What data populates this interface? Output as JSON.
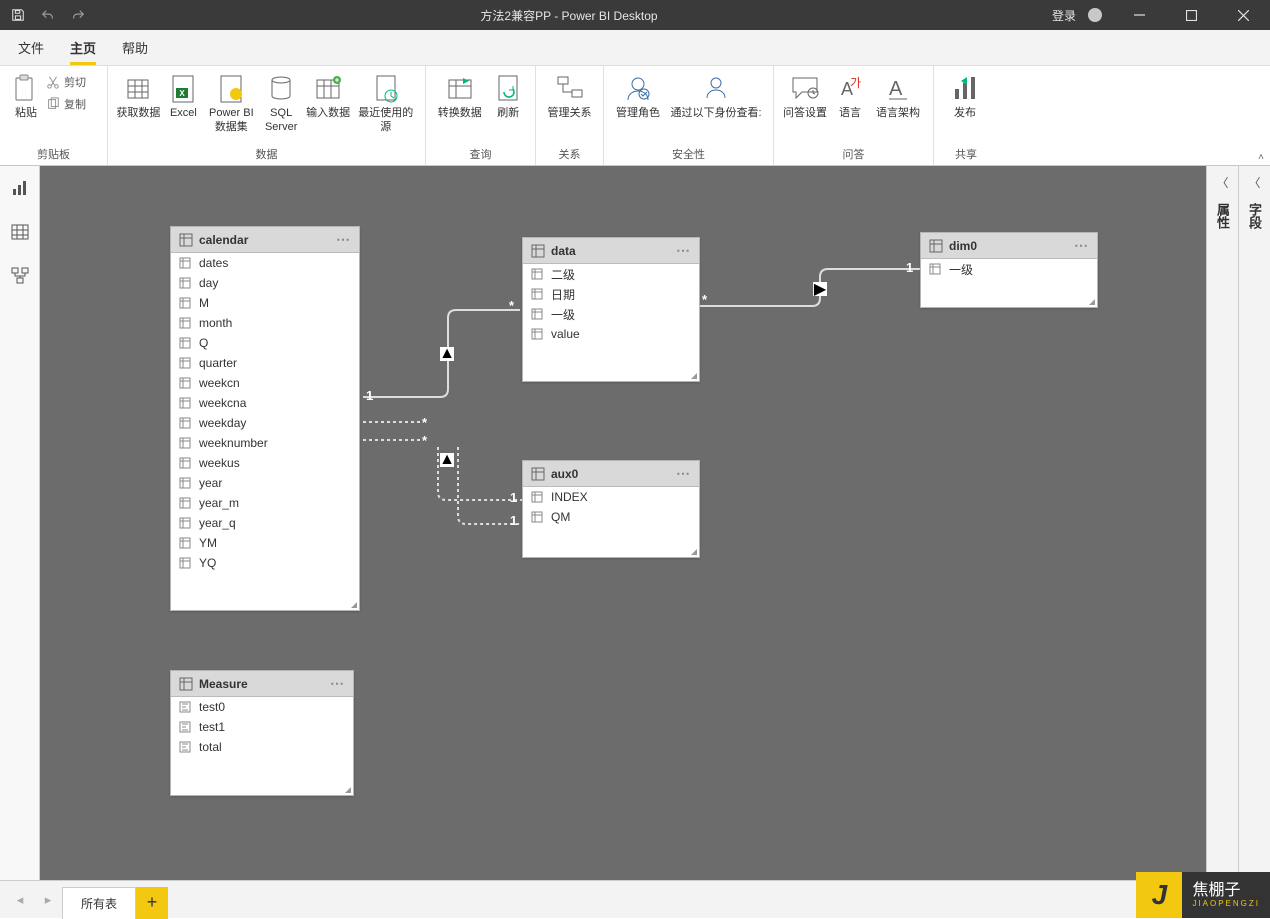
{
  "titlebar": {
    "title": "方法2兼容PP - Power BI Desktop",
    "login": "登录"
  },
  "menu": {
    "file": "文件",
    "home": "主页",
    "help": "帮助"
  },
  "ribbon": {
    "clipboard": {
      "label": "剪贴板",
      "paste": "粘贴",
      "cut": "剪切",
      "copy": "复制"
    },
    "data": {
      "label": "数据",
      "getdata": "获取数据",
      "excel": "Excel",
      "pbids": "Power BI 数据集",
      "sql": "SQL Server",
      "enter": "输入数据",
      "recent": "最近使用的源"
    },
    "query": {
      "label": "查询",
      "transform": "转换数据",
      "refresh": "刷新"
    },
    "rel": {
      "label": "关系",
      "manage": "管理关系"
    },
    "security": {
      "label": "安全性",
      "roles": "管理角色",
      "viewas": "通过以下身份查看:"
    },
    "qa": {
      "label": "问答",
      "setup": "问答设置",
      "lang": "语言",
      "schema": "语言架构"
    },
    "share": {
      "label": "共享",
      "publish": "发布"
    }
  },
  "tables": {
    "calendar": {
      "name": "calendar",
      "fields": [
        "dates",
        "day",
        "M",
        "month",
        "Q",
        "quarter",
        "weekcn",
        "weekcna",
        "weekday",
        "weeknumber",
        "weekus",
        "year",
        "year_m",
        "year_q",
        "YM",
        "YQ"
      ]
    },
    "data": {
      "name": "data",
      "fields": [
        "二级",
        "日期",
        "一级",
        "value"
      ]
    },
    "dim0": {
      "name": "dim0",
      "fields": [
        "一级"
      ]
    },
    "aux0": {
      "name": "aux0",
      "fields": [
        "INDEX",
        "QM"
      ]
    },
    "measure": {
      "name": "Measure",
      "fields": [
        "test0",
        "test1",
        "total"
      ]
    }
  },
  "panes": {
    "properties": "属性",
    "fields": "字段"
  },
  "bottom": {
    "alltables": "所有表"
  },
  "watermark": {
    "cn": "焦棚子",
    "py": "JIAOPENGZI"
  }
}
